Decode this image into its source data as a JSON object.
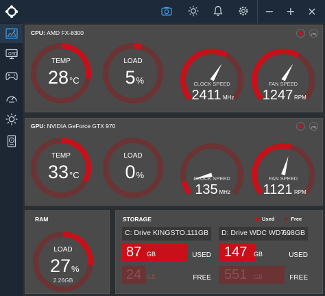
{
  "sidebar": {
    "items": [
      {
        "icon": "dashboard-icon",
        "active": true
      },
      {
        "icon": "monitor-icon",
        "active": false
      },
      {
        "icon": "gamepad-icon",
        "active": false
      },
      {
        "icon": "speedometer-icon",
        "active": false
      },
      {
        "icon": "brightness-icon",
        "active": false
      },
      {
        "icon": "drive-icon",
        "active": false
      }
    ]
  },
  "titlebar": {
    "icons": [
      "camera-icon",
      "brightness-icon",
      "bell-icon",
      "gear-icon"
    ],
    "minimize": "−",
    "maximize": "+",
    "close": "×"
  },
  "cpu": {
    "label": "CPU:",
    "name": "AMD FX-8300",
    "temp": {
      "label": "TEMP",
      "value": "28",
      "unit": "°C",
      "fill": 0.28
    },
    "load": {
      "label": "LOAD",
      "value": "5",
      "unit": "%",
      "fill": 0.05
    },
    "clock": {
      "label": "CLOCK SPEED",
      "value": "2411",
      "unit": "MHz",
      "fill": 0.62
    },
    "fan": {
      "label": "FAN SPEED",
      "value": "1247",
      "unit": "RPM",
      "fill": 0.62
    }
  },
  "gpu": {
    "label": "GPU:",
    "name": "NVIDIA GeForce GTX 970",
    "temp": {
      "label": "TEMP",
      "value": "33",
      "unit": "°C",
      "fill": 0.33
    },
    "load": {
      "label": "LOAD",
      "value": "0",
      "unit": "%",
      "fill": 0.0
    },
    "clock": {
      "label": "CLOCK SPEED",
      "value": "135",
      "unit": "MHz",
      "fill": 0.1
    },
    "fan": {
      "label": "FAN SPEED",
      "value": "1121",
      "unit": "RPM",
      "fill": 0.56
    }
  },
  "ram": {
    "title": "RAM",
    "label": "LOAD",
    "value": "27",
    "unit": "%",
    "detail": "2.26GB",
    "fill": 0.27
  },
  "storage": {
    "title": "STORAGE",
    "legend_used": "Used",
    "legend_free": "Free",
    "drives": [
      {
        "name": "C: Drive KINGSTO...",
        "size": "111GB",
        "used": "87",
        "free": "24",
        "unit": "GB",
        "used_label": "USED",
        "free_label": "FREE",
        "used_fraction": 0.78
      },
      {
        "name": "D: Drive WDC WD7...",
        "size": "698GB",
        "used": "147",
        "free": "551",
        "unit": "GB",
        "used_label": "USED",
        "free_label": "FREE",
        "used_fraction": 0.21
      }
    ]
  },
  "colors": {
    "accent": "#c8101a",
    "track": "#6b3333",
    "panel": "#4a4a4a"
  }
}
